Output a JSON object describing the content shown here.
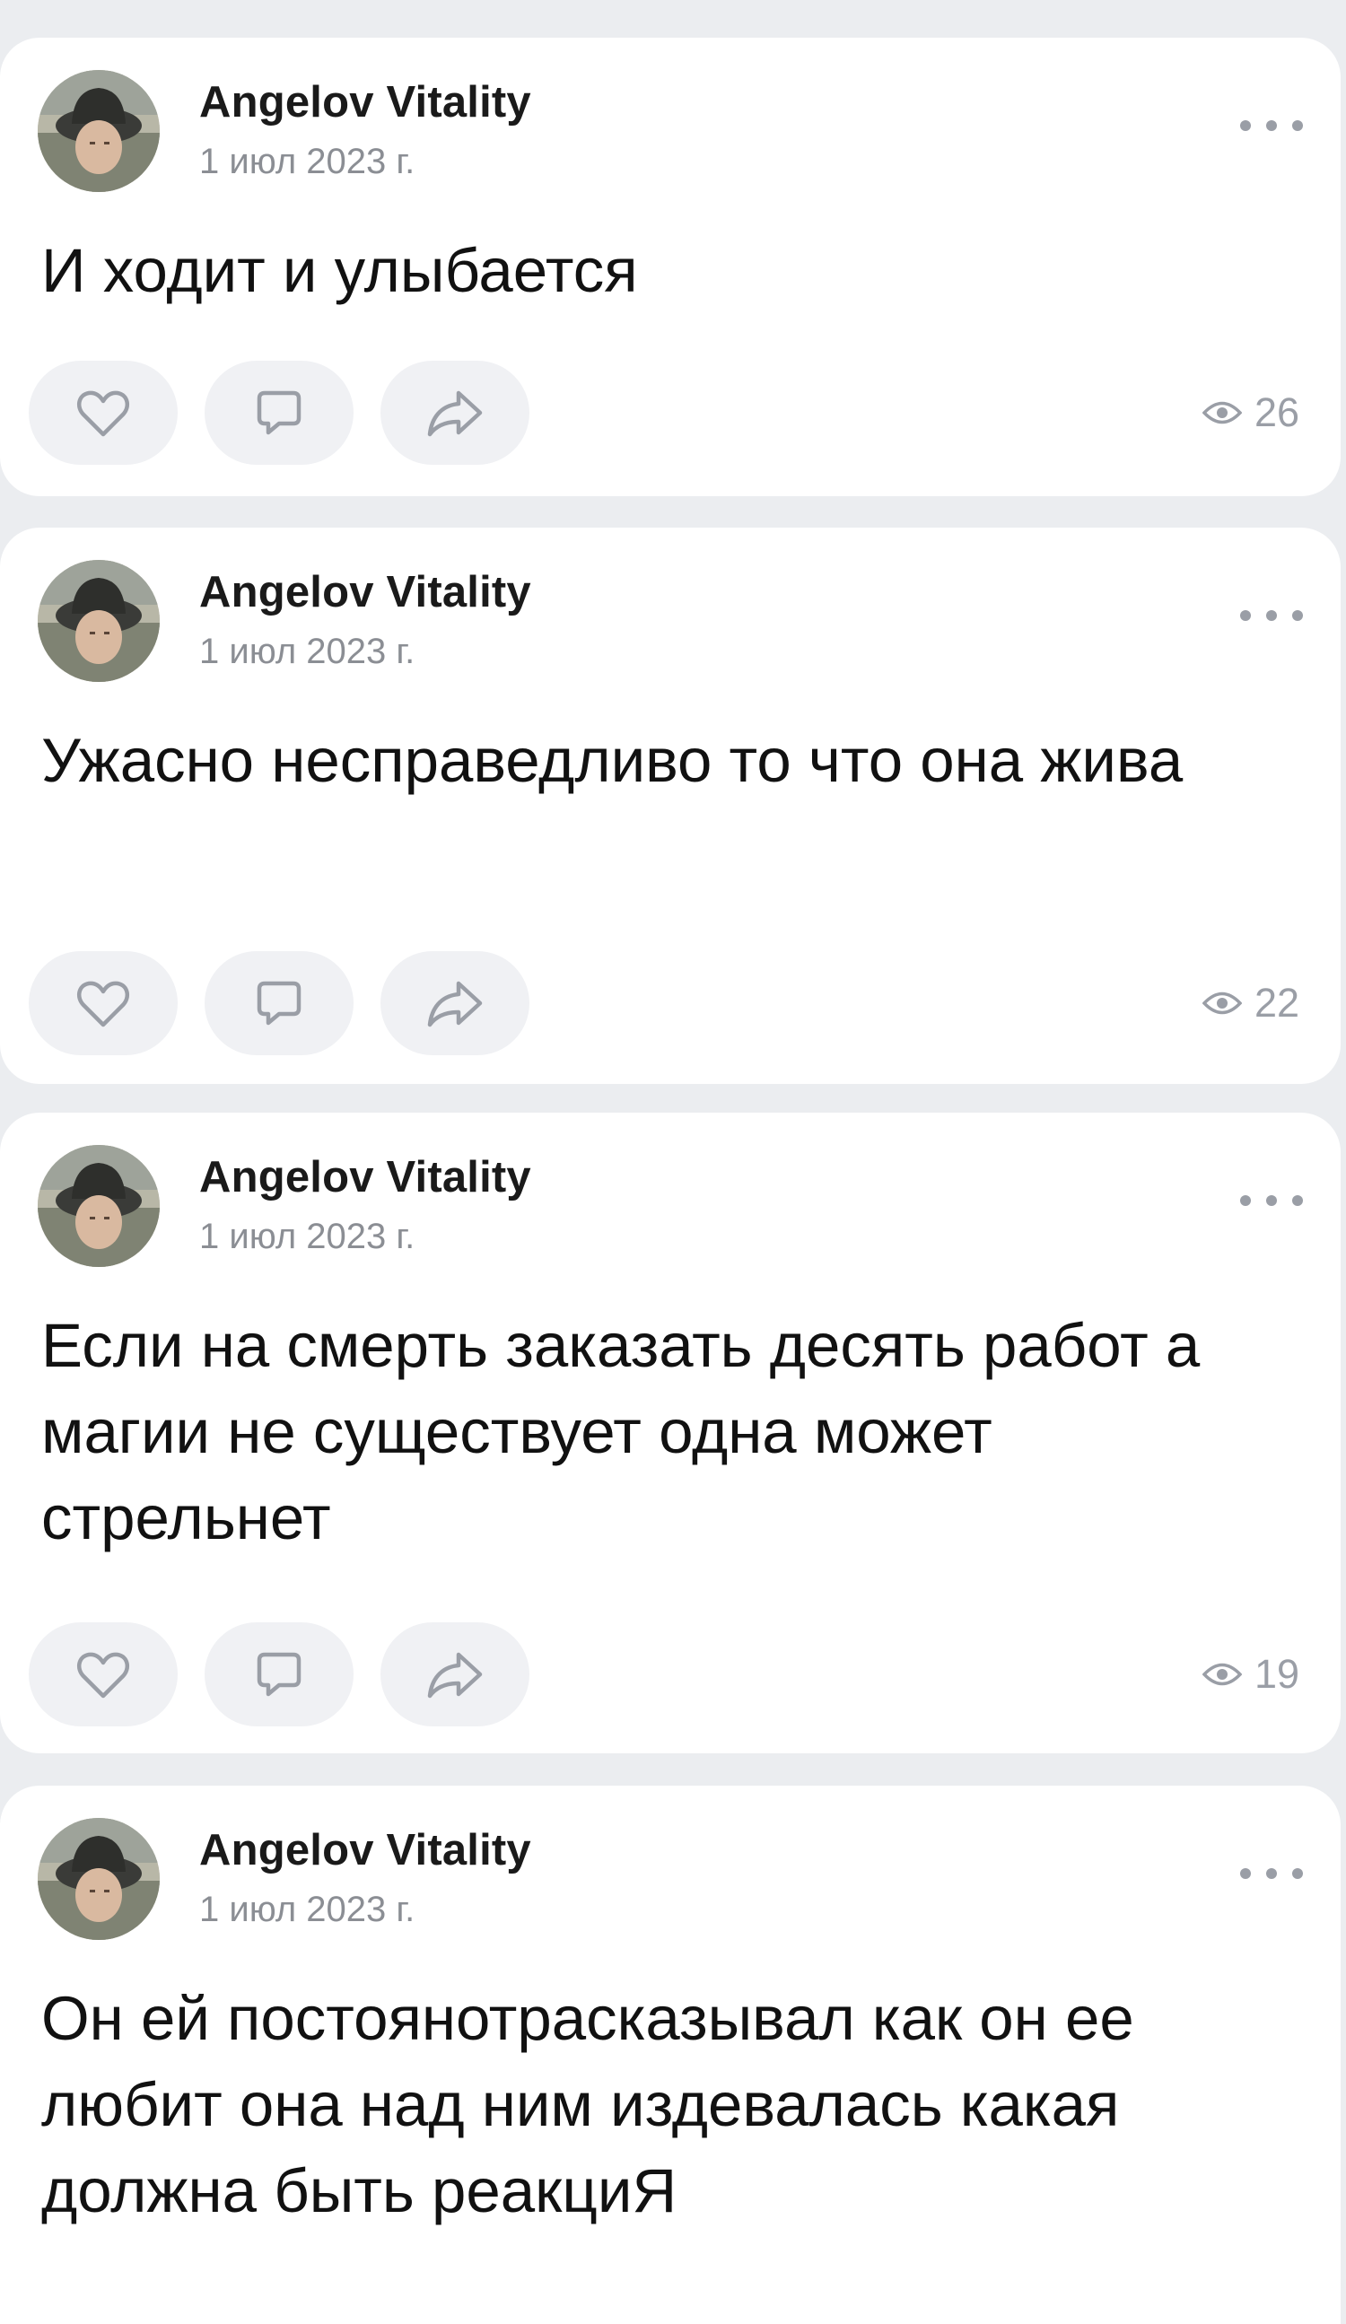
{
  "posts": [
    {
      "author": "Angelov Vitality",
      "date": "1 июл 2023 г.",
      "text": "И ходит и улыбается",
      "views": "26"
    },
    {
      "author": "Angelov Vitality",
      "date": "1 июл 2023 г.",
      "text": "Ужасно несправедливо то что она жива",
      "views": "22"
    },
    {
      "author": "Angelov Vitality",
      "date": "1 июл 2023 г.",
      "text": "Если на смерть заказать десять работ а магии не существует одна может стрельнет",
      "views": "19"
    },
    {
      "author": "Angelov Vitality",
      "date": "1 июл 2023 г.",
      "text": "Он ей постоянотрасказывал как он ее любит она над ним издевалась какая должна быть реакциЯ"
    }
  ],
  "icons": {
    "avatar": "user-photo",
    "menu": "more-dots-icon",
    "like": "heart-icon",
    "comment": "comment-bubble-icon",
    "share": "share-arrow-icon",
    "views": "eye-icon"
  },
  "colors": {
    "background": "#ebedf0",
    "card": "#ffffff",
    "button": "#f0f1f4",
    "icon": "#9a9ea6",
    "text": "#111111",
    "muted": "#8b8e94"
  }
}
